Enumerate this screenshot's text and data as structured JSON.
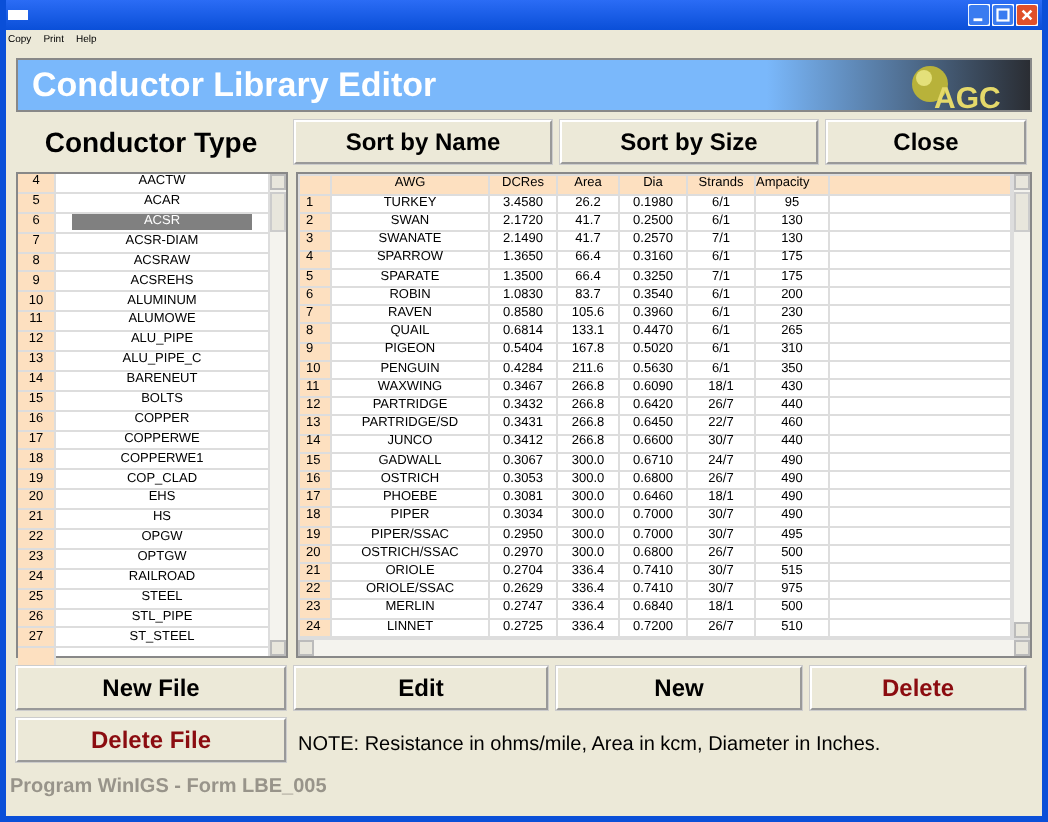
{
  "menu": [
    "Copy",
    "Print",
    "Help"
  ],
  "banner": {
    "title": "Conductor Library Editor",
    "logo": "AGC"
  },
  "section_label": "Conductor Type",
  "top_buttons": [
    {
      "label": "Sort by Name",
      "danger": false
    },
    {
      "label": "Sort by Size",
      "danger": false
    },
    {
      "label": "Close",
      "danger": false
    }
  ],
  "conductor_types": [
    {
      "number": "4",
      "name": "AACTW",
      "selected": false
    },
    {
      "number": "5",
      "name": "ACAR",
      "selected": false
    },
    {
      "number": "6",
      "name": "ACSR",
      "selected": true
    },
    {
      "number": "7",
      "name": "ACSR-DIAM",
      "selected": false
    },
    {
      "number": "8",
      "name": "ACSRAW",
      "selected": false
    },
    {
      "number": "9",
      "name": "ACSREHS",
      "selected": false
    },
    {
      "number": "10",
      "name": "ALUMINUM",
      "selected": false
    },
    {
      "number": "11",
      "name": "ALUMOWE",
      "selected": false
    },
    {
      "number": "12",
      "name": "ALU_PIPE",
      "selected": false
    },
    {
      "number": "13",
      "name": "ALU_PIPE_C",
      "selected": false
    },
    {
      "number": "14",
      "name": "BARENEUT",
      "selected": false
    },
    {
      "number": "15",
      "name": "BOLTS",
      "selected": false
    },
    {
      "number": "16",
      "name": "COPPER",
      "selected": false
    },
    {
      "number": "17",
      "name": "COPPERWE",
      "selected": false
    },
    {
      "number": "18",
      "name": "COPPERWE1",
      "selected": false
    },
    {
      "number": "19",
      "name": "COP_CLAD",
      "selected": false
    },
    {
      "number": "20",
      "name": "EHS",
      "selected": false
    },
    {
      "number": "21",
      "name": "HS",
      "selected": false
    },
    {
      "number": "22",
      "name": "OPGW",
      "selected": false
    },
    {
      "number": "23",
      "name": "OPTGW",
      "selected": false
    },
    {
      "number": "24",
      "name": "RAILROAD",
      "selected": false
    },
    {
      "number": "25",
      "name": "STEEL",
      "selected": false
    },
    {
      "number": "26",
      "name": "STL_PIPE",
      "selected": false
    },
    {
      "number": "27",
      "name": "ST_STEEL",
      "selected": false
    }
  ],
  "grid": {
    "columns": [
      "",
      "AWG",
      "DCRes",
      "Area",
      "Dia",
      "Strands",
      "Ampacity"
    ],
    "rows": [
      [
        "1",
        "TURKEY",
        "3.4580",
        "26.2",
        "0.1980",
        "6/1",
        "95"
      ],
      [
        "2",
        "SWAN",
        "2.1720",
        "41.7",
        "0.2500",
        "6/1",
        "130"
      ],
      [
        "3",
        "SWANATE",
        "2.1490",
        "41.7",
        "0.2570",
        "7/1",
        "130"
      ],
      [
        "4",
        "SPARROW",
        "1.3650",
        "66.4",
        "0.3160",
        "6/1",
        "175"
      ],
      [
        "5",
        "SPARATE",
        "1.3500",
        "66.4",
        "0.3250",
        "7/1",
        "175"
      ],
      [
        "6",
        "ROBIN",
        "1.0830",
        "83.7",
        "0.3540",
        "6/1",
        "200"
      ],
      [
        "7",
        "RAVEN",
        "0.8580",
        "105.6",
        "0.3960",
        "6/1",
        "230"
      ],
      [
        "8",
        "QUAIL",
        "0.6814",
        "133.1",
        "0.4470",
        "6/1",
        "265"
      ],
      [
        "9",
        "PIGEON",
        "0.5404",
        "167.8",
        "0.5020",
        "6/1",
        "310"
      ],
      [
        "10",
        "PENGUIN",
        "0.4284",
        "211.6",
        "0.5630",
        "6/1",
        "350"
      ],
      [
        "11",
        "WAXWING",
        "0.3467",
        "266.8",
        "0.6090",
        "18/1",
        "430"
      ],
      [
        "12",
        "PARTRIDGE",
        "0.3432",
        "266.8",
        "0.6420",
        "26/7",
        "440"
      ],
      [
        "13",
        "PARTRIDGE/SD",
        "0.3431",
        "266.8",
        "0.6450",
        "22/7",
        "460"
      ],
      [
        "14",
        "JUNCO",
        "0.3412",
        "266.8",
        "0.6600",
        "30/7",
        "440"
      ],
      [
        "15",
        "GADWALL",
        "0.3067",
        "300.0",
        "0.6710",
        "24/7",
        "490"
      ],
      [
        "16",
        "OSTRICH",
        "0.3053",
        "300.0",
        "0.6800",
        "26/7",
        "490"
      ],
      [
        "17",
        "PHOEBE",
        "0.3081",
        "300.0",
        "0.6460",
        "18/1",
        "490"
      ],
      [
        "18",
        "PIPER",
        "0.3034",
        "300.0",
        "0.7000",
        "30/7",
        "490"
      ],
      [
        "19",
        "PIPER/SSAC",
        "0.2950",
        "300.0",
        "0.7000",
        "30/7",
        "495"
      ],
      [
        "20",
        "OSTRICH/SSAC",
        "0.2970",
        "300.0",
        "0.6800",
        "26/7",
        "500"
      ],
      [
        "21",
        "ORIOLE",
        "0.2704",
        "336.4",
        "0.7410",
        "30/7",
        "515"
      ],
      [
        "22",
        "ORIOLE/SSAC",
        "0.2629",
        "336.4",
        "0.7410",
        "30/7",
        "975"
      ],
      [
        "23",
        "MERLIN",
        "0.2747",
        "336.4",
        "0.6840",
        "18/1",
        "500"
      ],
      [
        "24",
        "LINNET",
        "0.2725",
        "336.4",
        "0.7200",
        "26/7",
        "510"
      ]
    ]
  },
  "bottom_buttons": [
    {
      "label": "New File",
      "danger": false
    },
    {
      "label": "Edit",
      "danger": false
    },
    {
      "label": "New",
      "danger": false
    },
    {
      "label": "Delete",
      "danger": true
    }
  ],
  "delete_file_button": {
    "label": "Delete File",
    "danger": true
  },
  "note": "NOTE: Resistance in ohms/mile,  Area in kcm,  Diameter in Inches.",
  "footer": "Program WinIGS - Form LBE_005"
}
